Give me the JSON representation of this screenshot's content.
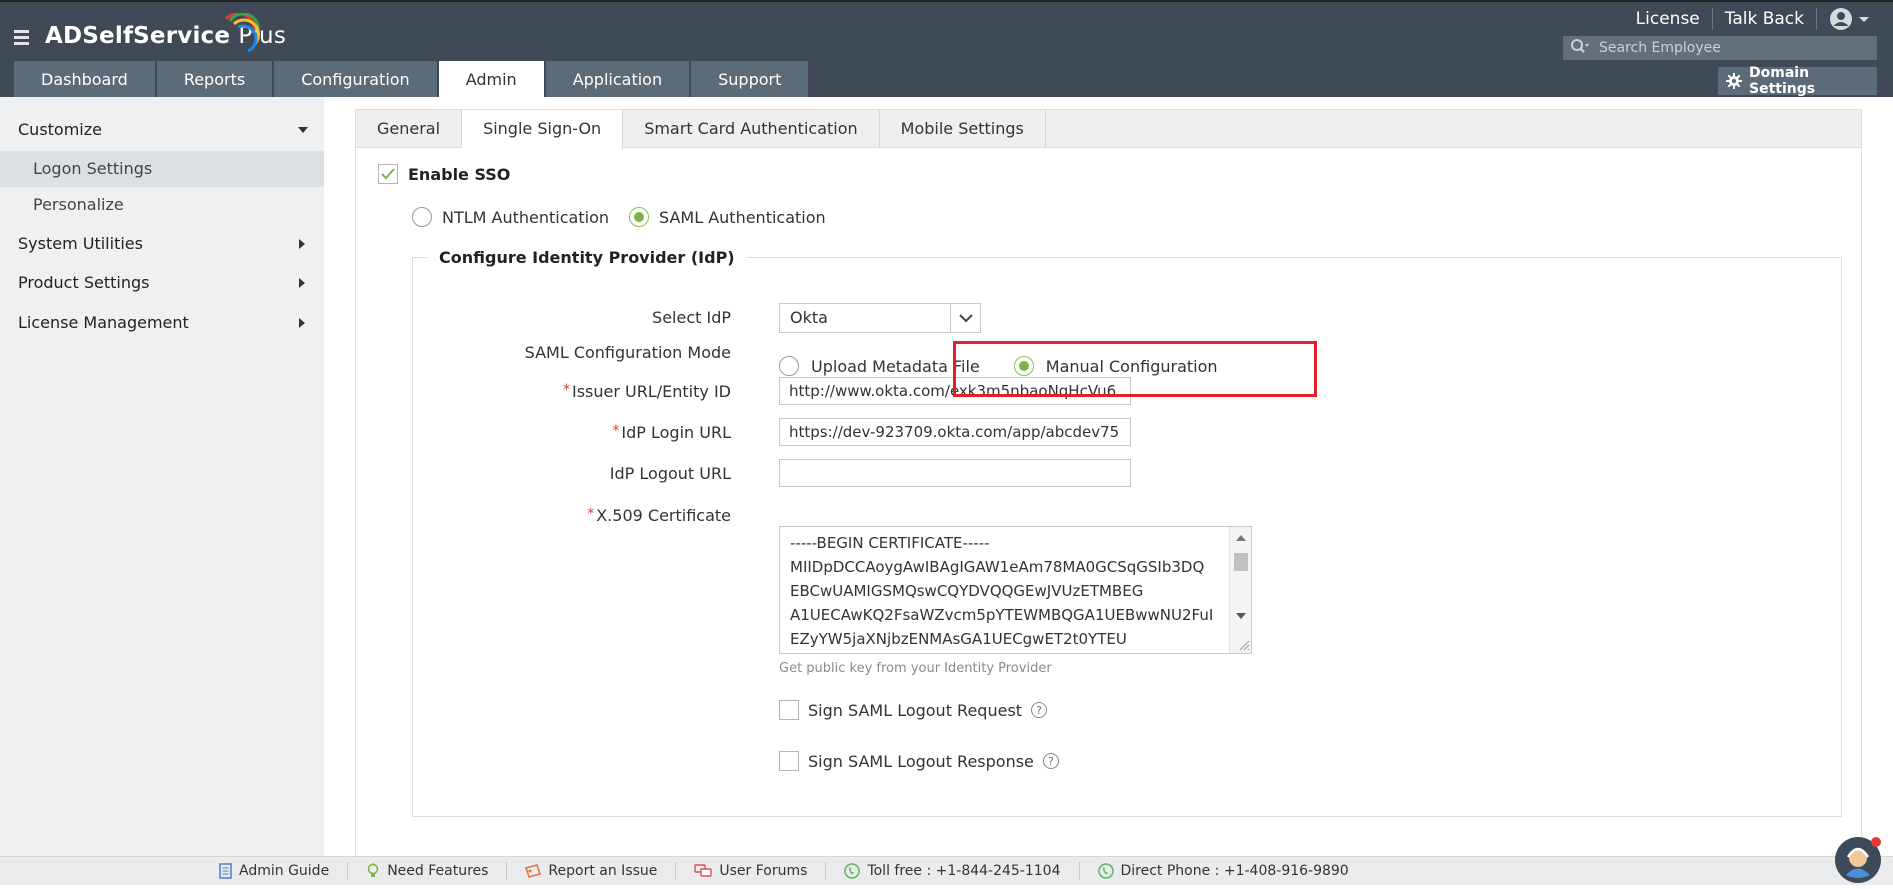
{
  "app": {
    "logo_text": "ADSelfService",
    "logo_plus": "Plus"
  },
  "top_links": {
    "license": "License",
    "talk_back": "Talk Back"
  },
  "search": {
    "placeholder": "Search Employee"
  },
  "nav_tabs": [
    "Dashboard",
    "Reports",
    "Configuration",
    "Admin",
    "Application",
    "Support"
  ],
  "nav_active": "Admin",
  "domain_settings": "Domain Settings",
  "sidebar": {
    "customize": "Customize",
    "logon_settings": "Logon Settings",
    "personalize": "Personalize",
    "system_utilities": "System Utilities",
    "product_settings": "Product Settings",
    "license_management": "License Management"
  },
  "sub_tabs": [
    "General",
    "Single Sign-On",
    "Smart Card Authentication",
    "Mobile Settings"
  ],
  "sub_tab_active": "Single Sign-On",
  "sso": {
    "enable_label": "Enable SSO",
    "enabled": true,
    "ntlm_label": "NTLM Authentication",
    "saml_label": "SAML Authentication",
    "auth_mode": "SAML Authentication"
  },
  "idp": {
    "legend": "Configure Identity Provider (IdP)",
    "select_idp_label": "Select IdP",
    "select_idp_value": "Okta",
    "mode_label": "SAML Configuration Mode",
    "upload_label": "Upload Metadata File",
    "manual_label": "Manual Configuration",
    "mode_value": "Manual Configuration",
    "issuer_label": "Issuer URL/Entity ID",
    "issuer_value": "http://www.okta.com/exk3m5nbaoNqHcVu6",
    "login_label": "IdP Login URL",
    "login_value": "https://dev-923709.okta.com/app/abcdev75",
    "logout_label": "IdP Logout URL",
    "logout_value": "",
    "cert_label": "X.509 Certificate",
    "cert_lines": [
      "-----BEGIN CERTIFICATE-----",
      "MIIDpDCCAoygAwIBAgIGAW1eAm78MA0GCSqGSIb3DQ",
      "EBCwUAMIGSMQswCQYDVQQGEwJVUzETMBEG",
      "A1UECAwKQ2FsaWZvcm5pYTEWMBQGA1UEBwwNU2FuI",
      "EZyYW5jaXNjbzENMAsGA1UECgwET2t0YTEU"
    ],
    "cert_hint": "Get public key from your Identity Provider",
    "sign_request_label": "Sign SAML Logout Request",
    "sign_response_label": "Sign SAML Logout Response",
    "sign_request": false,
    "sign_response": false
  },
  "footer": {
    "admin_guide": "Admin Guide",
    "need_features": "Need Features",
    "report_issue": "Report an Issue",
    "user_forums": "User Forums",
    "toll_free": "Toll free : +1-844-245-1104",
    "direct_phone": "Direct Phone : +1-408-916-9890"
  },
  "colors": {
    "header_bg": "#3f4a56",
    "tab_bg": "#5c6b78",
    "accent_green": "#7cb342",
    "highlight_red": "#e0202b"
  }
}
